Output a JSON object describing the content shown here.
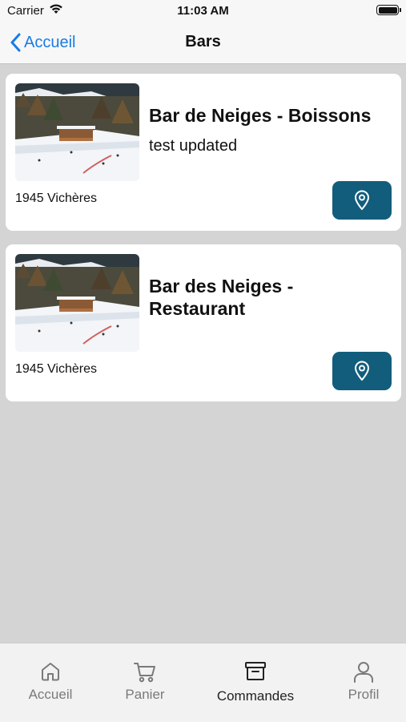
{
  "status_bar": {
    "carrier": "Carrier",
    "time": "11:03 AM"
  },
  "nav": {
    "back_label": "Accueil",
    "title": "Bars"
  },
  "bars": [
    {
      "title": "Bar de Neiges - Boissons",
      "description": "test updated",
      "location": "1945 Vichères",
      "image": "ski-chalet-photo"
    },
    {
      "title": "Bar des Neiges - Restaurant",
      "description": "",
      "location": "1945 Vichères",
      "image": "ski-chalet-photo"
    }
  ],
  "tabs": [
    {
      "label": "Accueil",
      "icon": "home-icon"
    },
    {
      "label": "Panier",
      "icon": "cart-icon"
    },
    {
      "label": "Commandes",
      "icon": "archive-box-icon"
    },
    {
      "label": "Profil",
      "icon": "person-icon"
    }
  ],
  "colors": {
    "accent": "#1a7ce6",
    "map_button": "#125d7c",
    "background": "#d4d4d4"
  }
}
